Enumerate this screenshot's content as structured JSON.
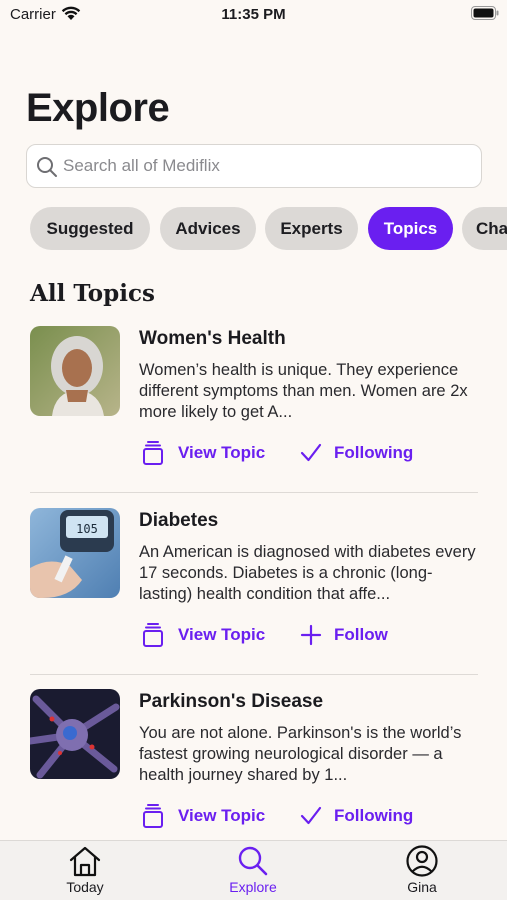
{
  "status_bar": {
    "carrier": "Carrier",
    "time": "11:35 PM"
  },
  "page": {
    "title": "Explore"
  },
  "search": {
    "placeholder": "Search all of Mediflix"
  },
  "tabs": [
    {
      "label": "Suggested",
      "active": false
    },
    {
      "label": "Advices",
      "active": false
    },
    {
      "label": "Experts",
      "active": false
    },
    {
      "label": "Topics",
      "active": true
    },
    {
      "label": "Cha",
      "active": false
    }
  ],
  "section": {
    "title": "All Topics"
  },
  "topics": [
    {
      "title": "Women's Health",
      "description": "Women’s health is unique. They experience different symptoms than men. Women are 2x more likely to get A...",
      "view_label": "View Topic",
      "follow_label": "Following",
      "following": true
    },
    {
      "title": "Diabetes",
      "description": "An American is diagnosed with diabetes every 17 seconds. Diabetes is a chronic (long-lasting) health condition that affe...",
      "view_label": "View Topic",
      "follow_label": "Follow",
      "following": false
    },
    {
      "title": "Parkinson's Disease",
      "description": "You are not alone. Parkinson's is the world’s fastest growing neurological disorder — a health journey shared by 1...",
      "view_label": "View Topic",
      "follow_label": "Following",
      "following": true
    }
  ],
  "tab_bar": [
    {
      "label": "Today",
      "icon": "house-icon",
      "active": false
    },
    {
      "label": "Explore",
      "icon": "magnifier-icon",
      "active": true
    },
    {
      "label": "Gina",
      "icon": "person-circle-icon",
      "active": false
    }
  ],
  "colors": {
    "accent": "#6a1ff0",
    "background": "#fcf8f4",
    "chip": "#dcd9d6"
  }
}
